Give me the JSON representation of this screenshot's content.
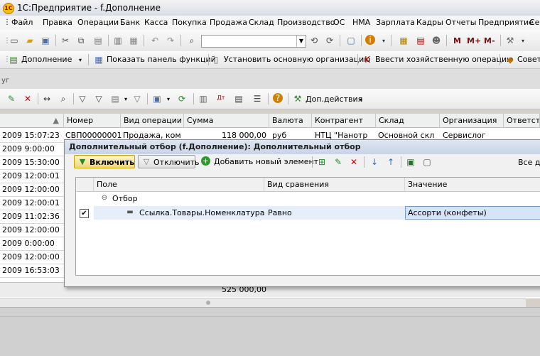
{
  "window": {
    "title": "1С:Предприятие - f.Дополнение"
  },
  "menu": [
    "Файл",
    "Правка",
    "Операции",
    "Банк",
    "Касса",
    "Покупка",
    "Продажа",
    "Склад",
    "Производство",
    "ОС",
    "НМА",
    "Зарплата",
    "Кадры",
    "Отчеты",
    "Предприятие",
    "Се"
  ],
  "toolbar2": {
    "m_label": "М",
    "mplus_label": "М+",
    "mminus_label": "М-"
  },
  "panel": {
    "dopolnenie": "Дополнение",
    "show_panel": "Показать панель функций",
    "set_org": "Установить основную организацию",
    "enter_op": "Ввести хозяйственную операцию",
    "advice": "Советы"
  },
  "form": {
    "title_fragment": "уг",
    "actions_label": "Доп.действия"
  },
  "table": {
    "headers": [
      "Номер",
      "Вид операции",
      "Сумма",
      "Валюта",
      "Контрагент",
      "Склад",
      "Организация",
      "Ответств"
    ],
    "first_row": {
      "number": "СВП00000001",
      "op": "Продажа, ком",
      "sum": "118 000,00",
      "currency": "руб",
      "contractor": "НТЦ \"Нанотр",
      "warehouse": "Основной скл",
      "org": "Сервислог"
    },
    "dates": [
      "2009 15:07:23",
      "2009 9:00:00",
      "2009 15:30:00",
      "2009 12:00:01",
      "2009 12:00:00",
      "2009 12:00:01",
      "2009 11:02:36",
      "2009 12:00:00",
      "2009 0:00:00",
      "2009 12:00:00",
      "2009 16:53:03"
    ],
    "total": "525 000,00"
  },
  "dialog": {
    "title": "Дополнительный отбор (f.Дополнение): Дополнительный отбор",
    "enable_label": "Включить",
    "disable_label": "Отключить",
    "add_label": "Добавить новый элемент",
    "right_text": "Все де",
    "columns": [
      "Поле",
      "Вид сравнения",
      "Значение"
    ],
    "group_label": "Отбор",
    "row": {
      "field": "Ссылка.Товары.Номенклатура",
      "comparison": "Равно",
      "value": "Ассорти (конфеты)",
      "checked": true
    }
  }
}
